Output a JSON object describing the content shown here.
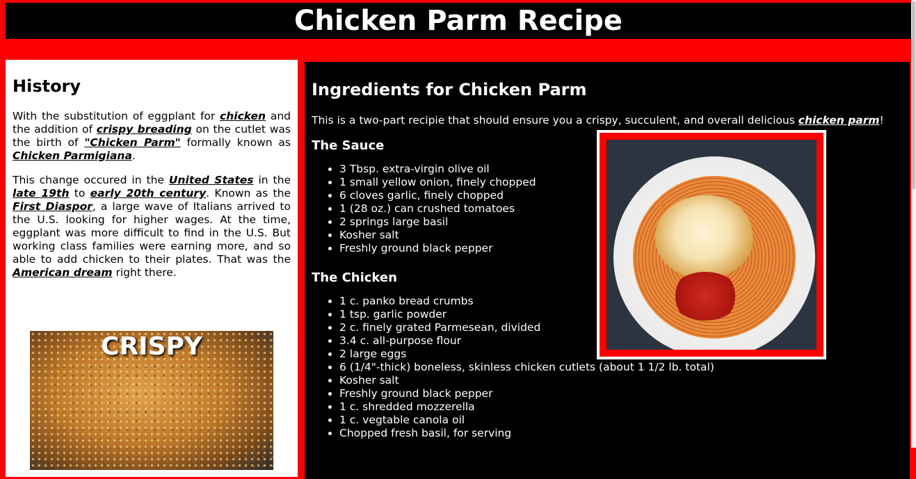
{
  "header": {
    "title": "Chicken Parm Recipe"
  },
  "history": {
    "heading": "History",
    "p1": {
      "t1": "With the substitution of eggplant for ",
      "link_chicken": "chicken",
      "t2": " and the addition of ",
      "link_crispy_breading": "crispy breading",
      "t3": " on the cutlet was the birth of ",
      "link_chicken_parm": "\"Chicken Parm\"",
      "t4": " formally known as ",
      "link_chicken_parmigiana": "Chicken Parmigiana",
      "t5": "."
    },
    "p2": {
      "t1": "This change occured in the ",
      "link_united_states": "United States",
      "t2": " in the ",
      "link_late_19th": "late 19th",
      "t3": " to ",
      "link_early_20th": "early 20th century",
      "t4": ". Known as the ",
      "link_first_diaspora": "First Diaspor",
      "t5": ", a large wave of Italians arrived to the U.S. looking for higher wages. At the time, eggplant was more difficult to find in the U.S. But working class families were earning more, and so able to add chicken to their plates. That was the ",
      "link_american_dream": "American dream",
      "t6": " right there."
    },
    "image_caption": "CRISPY"
  },
  "ingredients": {
    "heading": "Ingredients for Chicken Parm",
    "intro": {
      "t1": "This is a two-part recipie that should ensure you a crispy, succulent, and overall delicious ",
      "link_chicken_parm": "chicken parm",
      "t2": "!"
    },
    "sauce": {
      "heading": "The Sauce",
      "items": [
        "3 Tbsp. extra-virgin olive oil",
        "1 small yellow onion, finely chopped",
        "6 cloves garlic, finely chopped",
        "1 (28 oz.) can crushed tomatoes",
        "2 springs large basil",
        "Kosher salt",
        "Freshly ground black pepper"
      ]
    },
    "chicken": {
      "heading": "The Chicken",
      "items": [
        "1 c. panko bread crumbs",
        "1 tsp. garlic powder",
        "2 c. finely grated Parmesean, divided",
        "3.4 c. all-purpose flour",
        "2 large eggs",
        "6 (1/4\"-thick) boneless, skinless chicken cutlets (about 1 1/2 lb. total)",
        "Kosher salt",
        "Freshly ground black pepper",
        "1 c. shredded mozzerella",
        "1 c. vegtable canola oil",
        "Chopped fresh basil, for serving"
      ]
    }
  }
}
